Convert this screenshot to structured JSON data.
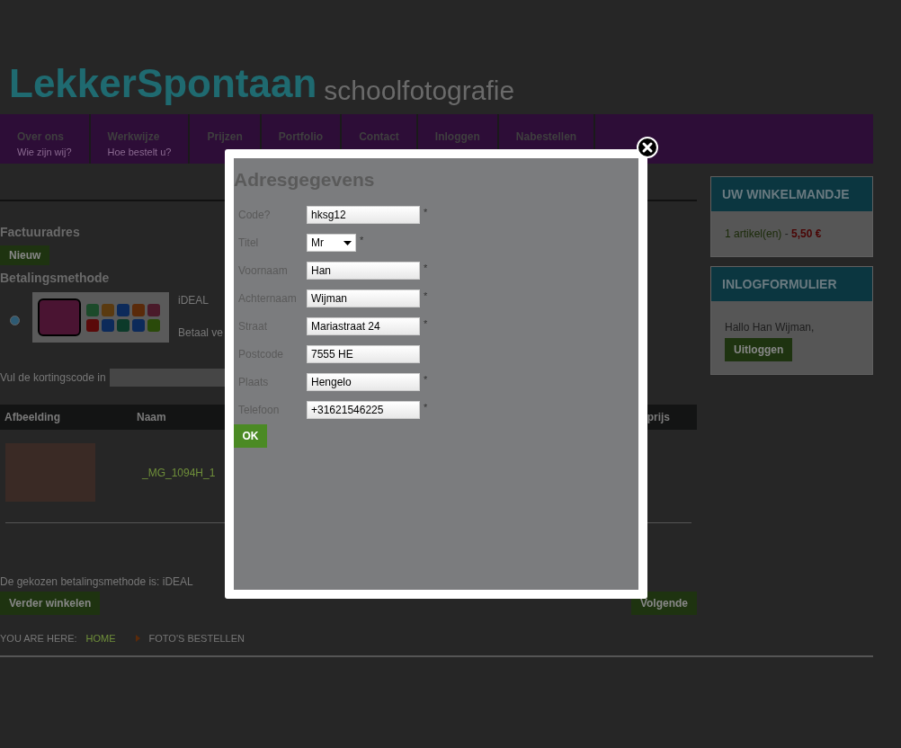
{
  "logo": {
    "brand": "LekkerSpontaan",
    "tagline": "schoolfotografie"
  },
  "nav": [
    {
      "title": "Over ons",
      "subtitle": "Wie zijn wij?"
    },
    {
      "title": "Werkwijze",
      "subtitle": "Hoe bestelt u?"
    },
    {
      "title": "Prijzen"
    },
    {
      "title": "Portfolio"
    },
    {
      "title": "Contact"
    },
    {
      "title": "Inloggen"
    },
    {
      "title": "Nabestellen"
    }
  ],
  "billing": {
    "heading": "Factuuradres",
    "button": "Nieuw"
  },
  "payment": {
    "heading": "Betalingsmethode",
    "options": [
      {
        "name": "iDEAL",
        "description": "Betaal ve",
        "selected": true
      }
    ]
  },
  "discount": {
    "label": "Vul de kortingscode in"
  },
  "table": {
    "columns": [
      "Afbeelding",
      "Naam",
      "prijs"
    ],
    "rows": [
      {
        "name": "_MG_1094H_1"
      }
    ]
  },
  "chosen_method": "De gekozen betalingsmethode is: iDEAL",
  "actions": {
    "back": "Verder winkelen",
    "next": "Volgende"
  },
  "breadcrumb": {
    "label": "YOU ARE HERE:",
    "items": [
      "HOME",
      "FOTO'S BESTELLEN"
    ]
  },
  "sidebar": [
    {
      "kind": "cart",
      "title": "UW WINKELMANDJE",
      "count": "1 artikel(en)",
      "separator": " - ",
      "price": "5,50 €"
    },
    {
      "kind": "login",
      "title": "INLOGFORMULIER",
      "greeting": "Hallo Han Wijman,",
      "button": "Uitloggen"
    }
  ],
  "modal": {
    "title": "Adresgegevens",
    "submit": "OK",
    "required_symbol": "*",
    "fields": [
      {
        "kind": "text",
        "label": "Code?",
        "value": "hksg12",
        "required": true
      },
      {
        "kind": "select",
        "label": "Titel",
        "value": "Mr",
        "required": true
      },
      {
        "kind": "text",
        "label": "Voornaam",
        "value": "Han",
        "required": true
      },
      {
        "kind": "text",
        "label": "Achternaam",
        "value": "Wijman",
        "required": true
      },
      {
        "kind": "text",
        "label": "Straat",
        "value": "Mariastraat 24",
        "required": true
      },
      {
        "kind": "text",
        "label": "Postcode",
        "value": "7555 HE",
        "required": false
      },
      {
        "kind": "text",
        "label": "Plaats",
        "value": "Hengelo",
        "required": true
      },
      {
        "kind": "text",
        "label": "Telefoon",
        "value": "+31621546225",
        "required": true
      }
    ]
  }
}
